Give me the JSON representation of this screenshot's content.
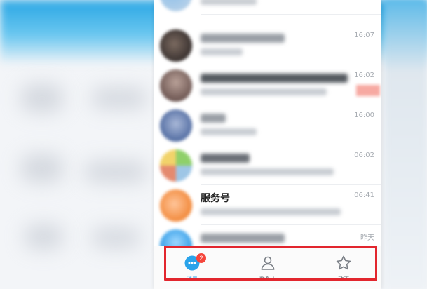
{
  "chats": [
    {
      "time": "16:07",
      "tail": ""
    },
    {
      "time": "16:02",
      "tail": ""
    },
    {
      "time": "16:00",
      "tail": ""
    },
    {
      "time": "06:02",
      "tail": ""
    },
    {
      "name": "服务号",
      "time": "06:41",
      "tail": ""
    },
    {
      "time": "昨天",
      "tail": ""
    }
  ],
  "tabs": [
    {
      "label": "消息",
      "badge": "2"
    },
    {
      "label": "联系人"
    },
    {
      "label": "动态"
    }
  ],
  "colors": {
    "accent": "#2aa3ea",
    "badge": "#f5463c",
    "highlight": "#e2262e"
  }
}
